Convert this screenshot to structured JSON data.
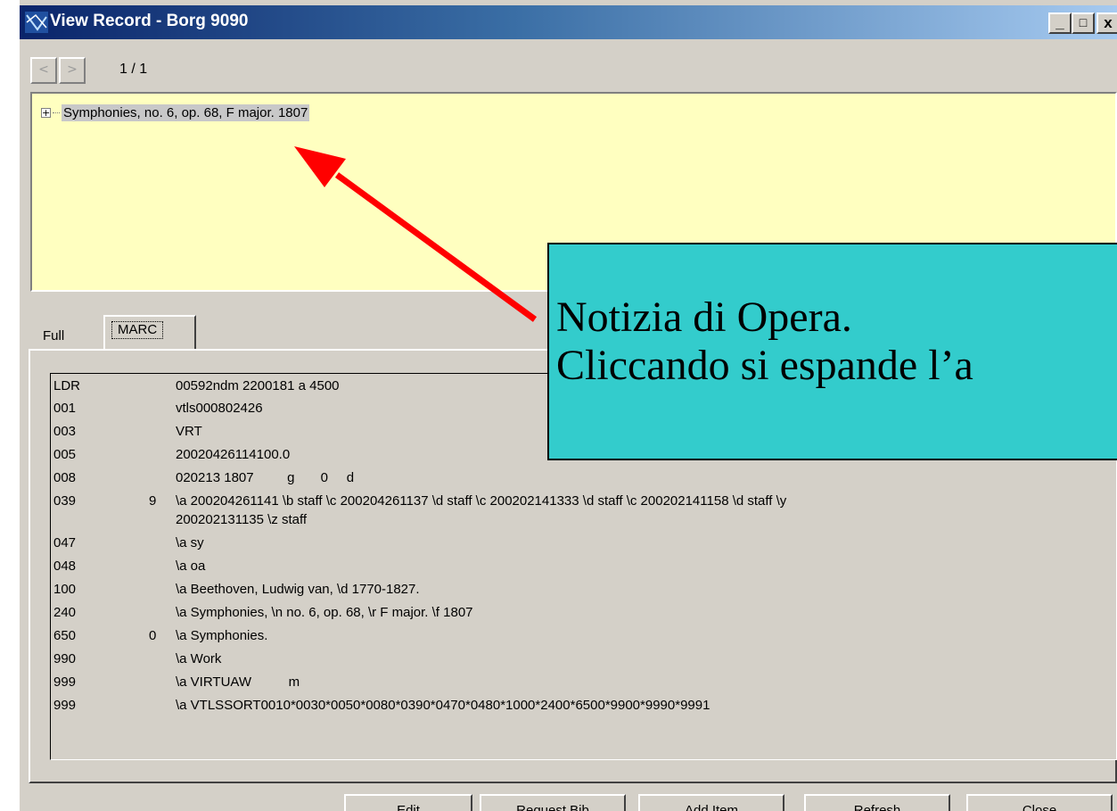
{
  "window": {
    "title": "View Record - Borg 9090",
    "controls": {
      "minimize": "_",
      "maximize": "□",
      "close": "x"
    }
  },
  "nav": {
    "prev_label": "<",
    "next_label": ">",
    "counter": "1 / 1"
  },
  "tree": {
    "expander": "+",
    "item_label": "Symphonies, no. 6, op. 68, F major. 1807"
  },
  "tabs": [
    {
      "label": "Full"
    },
    {
      "label": "MARC"
    }
  ],
  "marc": {
    "rows": [
      {
        "tag": "LDR",
        "ind": "",
        "data": "00592ndm  2200181 a 4500"
      },
      {
        "tag": "001",
        "ind": "",
        "data": "vtls000802426"
      },
      {
        "tag": "003",
        "ind": "",
        "data": "VRT"
      },
      {
        "tag": "005",
        "ind": "",
        "data": "20020426114100.0"
      },
      {
        "tag": "008",
        "ind": "",
        "data": "020213 1807         g       0     d"
      },
      {
        "tag": "039",
        "ind": "9",
        "data": "\\a 200204261141 \\b staff \\c 200204261137 \\d staff \\c 200202141333 \\d staff \\c 200202141158 \\d staff \\y"
      },
      {
        "tag": "",
        "ind": "",
        "data": "200202131135 \\z staff"
      },
      {
        "tag": "047",
        "ind": "",
        "data": "\\a sy"
      },
      {
        "tag": "048",
        "ind": "",
        "data": "\\a oa"
      },
      {
        "tag": "100",
        "ind": "",
        "data": "\\a Beethoven, Ludwig van, \\d 1770-1827."
      },
      {
        "tag": "240",
        "ind": "",
        "data": "\\a Symphonies, \\n no. 6, op. 68, \\r F major. \\f 1807"
      },
      {
        "tag": "650",
        "ind": "0",
        "data": "\\a Symphonies."
      },
      {
        "tag": "990",
        "ind": "",
        "data": "\\a Work"
      },
      {
        "tag": "999",
        "ind": "",
        "data": "\\a VIRTUAW          m"
      },
      {
        "tag": "999",
        "ind": "",
        "data": "\\a VTLSSORT0010*0030*0050*0080*0390*0470*0480*1000*2400*6500*9900*9990*9991"
      }
    ]
  },
  "buttons": {
    "edit": "Edit",
    "request_bib": "Request Bib",
    "add_item": "Add Item",
    "refresh": "Refresh",
    "close": "Close"
  },
  "callout": {
    "line1": "Notizia di Opera.",
    "line2": "Cliccando si espande l’a"
  },
  "colors": {
    "callout_bg": "#33cccc",
    "arrow": "#ff0000",
    "tree_bg": "#ffffc0",
    "title_start": "#0a246a"
  }
}
